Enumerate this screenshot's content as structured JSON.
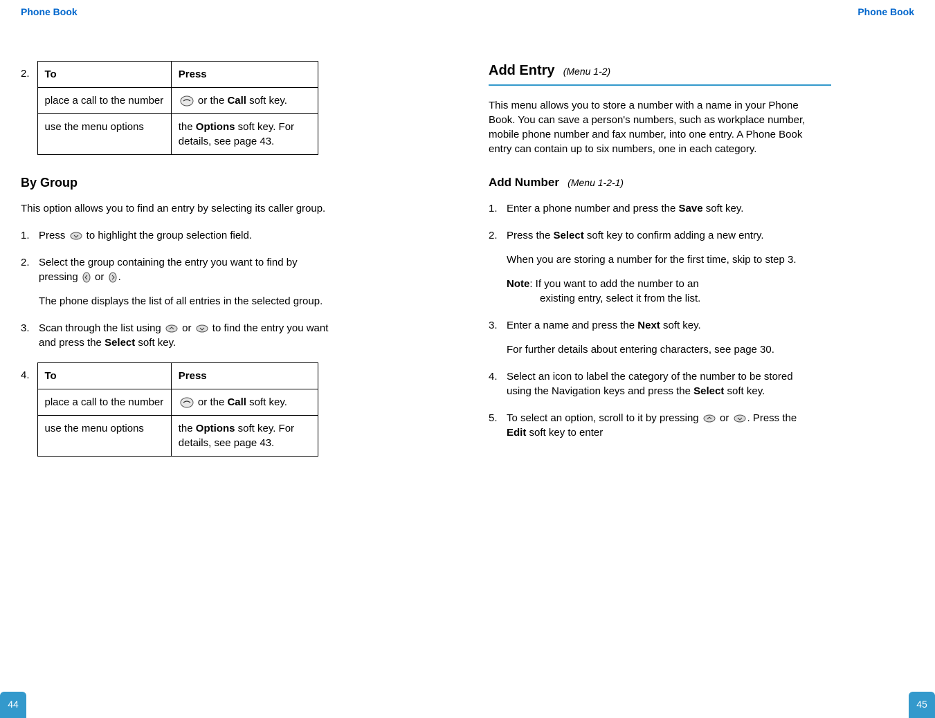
{
  "header_left": "Phone Book",
  "header_right": "Phone Book",
  "page_num_left": "44",
  "page_num_right": "45",
  "left": {
    "table1_num": "2.",
    "table1_h1": "To",
    "table1_h2": "Press",
    "table1_r1c1": "place a call to the number",
    "table1_r1c2a": " or the ",
    "table1_r1c2b": "Call",
    "table1_r1c2c": " soft key.",
    "table1_r2c1": "use the menu options",
    "table1_r2c2a": "the ",
    "table1_r2c2b": "Options",
    "table1_r2c2c": " soft key. For details, see page 43.",
    "by_group": "By Group",
    "by_group_intro": "This option allows you to find an entry by selecting its caller group.",
    "step1_num": "1.",
    "step1a": "Press ",
    "step1b": " to highlight the group selection field.",
    "step2_num": "2.",
    "step2a": "Select the group containing the entry you want to find by pressing ",
    "step2b": " or ",
    "step2c": ".",
    "step2_p2": "The phone displays the list of all entries in the selected group.",
    "step3_num": "3.",
    "step3a": "Scan through the list using ",
    "step3b": " or ",
    "step3c": " to find the entry you want and press the ",
    "step3d": "Select",
    "step3e": " soft key.",
    "table2_num": "4.",
    "table2_h1": "To",
    "table2_h2": "Press",
    "table2_r1c1": "place a call to the number",
    "table2_r1c2a": " or the ",
    "table2_r1c2b": "Call",
    "table2_r1c2c": " soft key.",
    "table2_r2c1": "use the menu options",
    "table2_r2c2a": "the ",
    "table2_r2c2b": "Options",
    "table2_r2c2c": " soft key. For details, see page 43."
  },
  "right": {
    "title": "Add Entry",
    "title_tag": "(Menu 1-2)",
    "intro": "This menu allows you to store a number with a name in your Phone Book. You can save a person's numbers, such as workplace number, mobile phone number and fax number, into one entry. A Phone Book entry can contain up to six numbers, one in each category.",
    "sub_title": "Add Number",
    "sub_tag": "(Menu 1-2-1)",
    "s1_num": "1.",
    "s1a": "Enter a phone number and press the ",
    "s1b": "Save",
    "s1c": " soft key.",
    "s2_num": "2.",
    "s2a": "Press the ",
    "s2b": "Select",
    "s2c": " soft key to confirm adding a new entry.",
    "s2_p2": "When you are storing a number for the first time, skip to step 3.",
    "note_label": "Note",
    "note_text1": ": If you want to add the number to an ",
    "note_text2": "existing entry, select it from the list.",
    "s3_num": "3.",
    "s3a": "Enter a name and press the ",
    "s3b": "Next",
    "s3c": " soft key.",
    "s3_p2": "For further details about entering characters, see page 30.",
    "s4_num": "4.",
    "s4a": "Select an icon to label the category of the number to be stored using the Navigation keys and press the ",
    "s4b": "Select",
    "s4c": " soft key.",
    "s5_num": "5.",
    "s5a": "To select an option, scroll to it by pressing ",
    "s5b": " or ",
    "s5c": ". Press the ",
    "s5d": "Edit",
    "s5e": " soft key to enter"
  }
}
